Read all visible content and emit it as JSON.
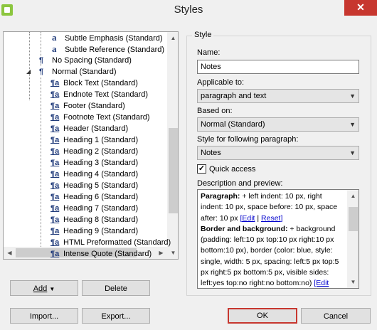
{
  "window": {
    "title": "Styles",
    "close_label": "✕"
  },
  "tree": {
    "items": [
      {
        "label": "Subtle Emphasis (Standard)",
        "glyph": "a",
        "kind": "char"
      },
      {
        "label": "Subtle Reference (Standard)",
        "glyph": "a",
        "kind": "char"
      },
      {
        "label": "No Spacing (Standard)",
        "glyph": "¶",
        "kind": "para-plain"
      },
      {
        "label": "Normal (Standard)",
        "glyph": "¶",
        "kind": "para-plain",
        "expanded": true
      },
      {
        "label": "Block Text (Standard)",
        "glyph": "¶a",
        "kind": "para"
      },
      {
        "label": "Endnote Text (Standard)",
        "glyph": "¶a",
        "kind": "para"
      },
      {
        "label": "Footer (Standard)",
        "glyph": "¶a",
        "kind": "para"
      },
      {
        "label": "Footnote Text (Standard)",
        "glyph": "¶a",
        "kind": "para"
      },
      {
        "label": "Header (Standard)",
        "glyph": "¶a",
        "kind": "para"
      },
      {
        "label": "Heading 1 (Standard)",
        "glyph": "¶a",
        "kind": "para"
      },
      {
        "label": "Heading 2 (Standard)",
        "glyph": "¶a",
        "kind": "para"
      },
      {
        "label": "Heading 3 (Standard)",
        "glyph": "¶a",
        "kind": "para"
      },
      {
        "label": "Heading 4 (Standard)",
        "glyph": "¶a",
        "kind": "para"
      },
      {
        "label": "Heading 5 (Standard)",
        "glyph": "¶a",
        "kind": "para"
      },
      {
        "label": "Heading 6 (Standard)",
        "glyph": "¶a",
        "kind": "para"
      },
      {
        "label": "Heading 7 (Standard)",
        "glyph": "¶a",
        "kind": "para"
      },
      {
        "label": "Heading 8 (Standard)",
        "glyph": "¶a",
        "kind": "para"
      },
      {
        "label": "Heading 9 (Standard)",
        "glyph": "¶a",
        "kind": "para"
      },
      {
        "label": "HTML Preformatted (Standard)",
        "glyph": "¶a",
        "kind": "para"
      },
      {
        "label": "Intense Quote (Standard)",
        "glyph": "¶a",
        "kind": "para"
      }
    ]
  },
  "left_buttons": {
    "add": "Add",
    "delete": "Delete",
    "import": "Import...",
    "export": "Export..."
  },
  "style_group": {
    "legend": "Style",
    "name_label": "Name:",
    "name_value": "Notes",
    "applicable_label": "Applicable to:",
    "applicable_value": "paragraph and text",
    "based_label": "Based on:",
    "based_value": "Normal (Standard)",
    "following_label": "Style for following paragraph:",
    "following_value": "Notes",
    "quick_access_label": "Quick access",
    "quick_access_checked": true,
    "desc_label": "Description and preview:",
    "desc": {
      "p1_bold": "Paragraph:",
      "p1_text": " + left indent: 10 px, right indent: 10 px, space before: 10 px, space after: 10 px ",
      "edit": "[Edit",
      "sep": " | ",
      "reset": "Reset]",
      "p2_bold": "Border and background:",
      "p2_text": " + background (padding: left:10 px top:10 px right:10 px bottom:10 px), border (color: blue, style: single, width: 5 px, spacing: left:5 px top:5 px right:5 px bottom:5 px, visible sides: left:yes top:no right:no bottom:no) ",
      "edit2": "[Edit"
    }
  },
  "dialog_buttons": {
    "ok": "OK",
    "cancel": "Cancel"
  },
  "colors": {
    "close": "#c7372f",
    "link": "#0000cc",
    "ok_border": "#c7372f"
  }
}
